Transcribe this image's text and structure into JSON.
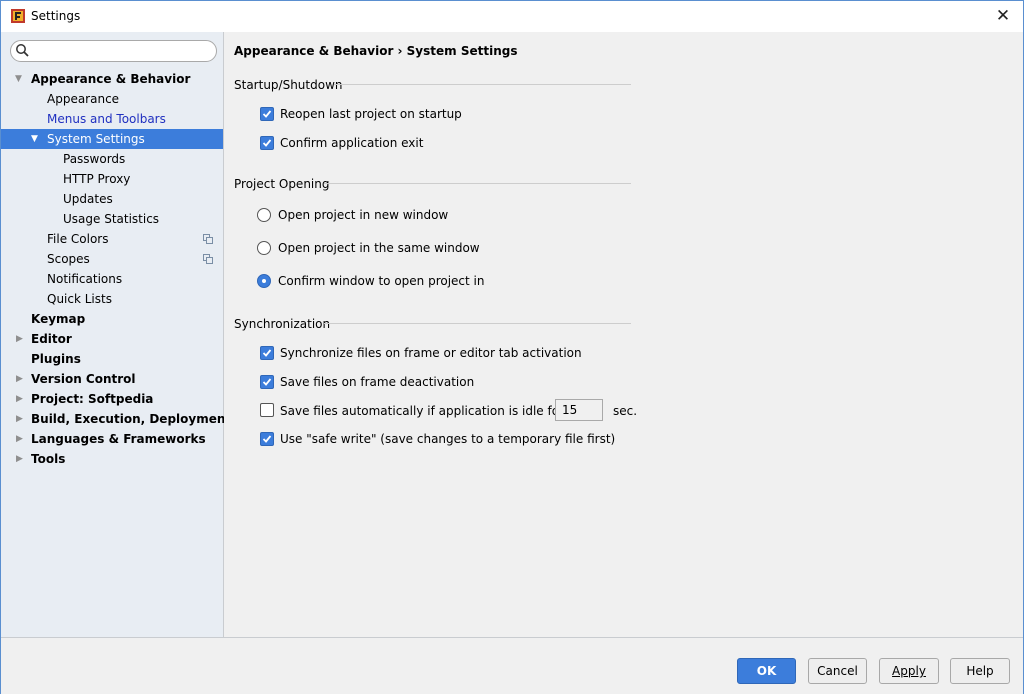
{
  "window": {
    "title": "Settings"
  },
  "sidebar": {
    "search_placeholder": "",
    "items": [
      {
        "label": "Appearance & Behavior"
      },
      {
        "label": "Appearance"
      },
      {
        "label": "Menus and Toolbars"
      },
      {
        "label": "System Settings"
      },
      {
        "label": "Passwords"
      },
      {
        "label": "HTTP Proxy"
      },
      {
        "label": "Updates"
      },
      {
        "label": "Usage Statistics"
      },
      {
        "label": "File Colors"
      },
      {
        "label": "Scopes"
      },
      {
        "label": "Notifications"
      },
      {
        "label": "Quick Lists"
      },
      {
        "label": "Keymap"
      },
      {
        "label": "Editor"
      },
      {
        "label": "Plugins"
      },
      {
        "label": "Version Control"
      },
      {
        "label": "Project: Softpedia"
      },
      {
        "label": "Build, Execution, Deployment"
      },
      {
        "label": "Languages & Frameworks"
      },
      {
        "label": "Tools"
      }
    ]
  },
  "content": {
    "breadcrumb": "Appearance & Behavior › System Settings",
    "startup": {
      "title": "Startup/Shutdown",
      "reopen_label": "Reopen last project on startup",
      "reopen_checked": true,
      "confirm_exit_label": "Confirm application exit",
      "confirm_exit_checked": true
    },
    "project_opening": {
      "title": "Project Opening",
      "options": [
        {
          "label": "Open project in new window",
          "selected": false
        },
        {
          "label": "Open project in the same window",
          "selected": false
        },
        {
          "label": "Confirm window to open project in",
          "selected": true
        }
      ]
    },
    "sync": {
      "title": "Synchronization",
      "sync_frame_label": "Synchronize files on frame or editor tab activation",
      "sync_frame_checked": true,
      "save_deactivation_label": "Save files on frame deactivation",
      "save_deactivation_checked": true,
      "autosave_label": "Save files automatically if application is idle for",
      "autosave_checked": false,
      "autosave_value": "15",
      "autosave_unit": "sec.",
      "safe_write_label": "Use \"safe write\" (save changes to a temporary file first)",
      "safe_write_checked": true
    }
  },
  "footer": {
    "ok_label": "OK",
    "cancel_label": "Cancel",
    "apply_label": "Apply",
    "help_label": "Help"
  },
  "colors": {
    "accent": "#3c7ddb",
    "sidebar_bg": "#e8edf3",
    "link": "#2030c0"
  }
}
